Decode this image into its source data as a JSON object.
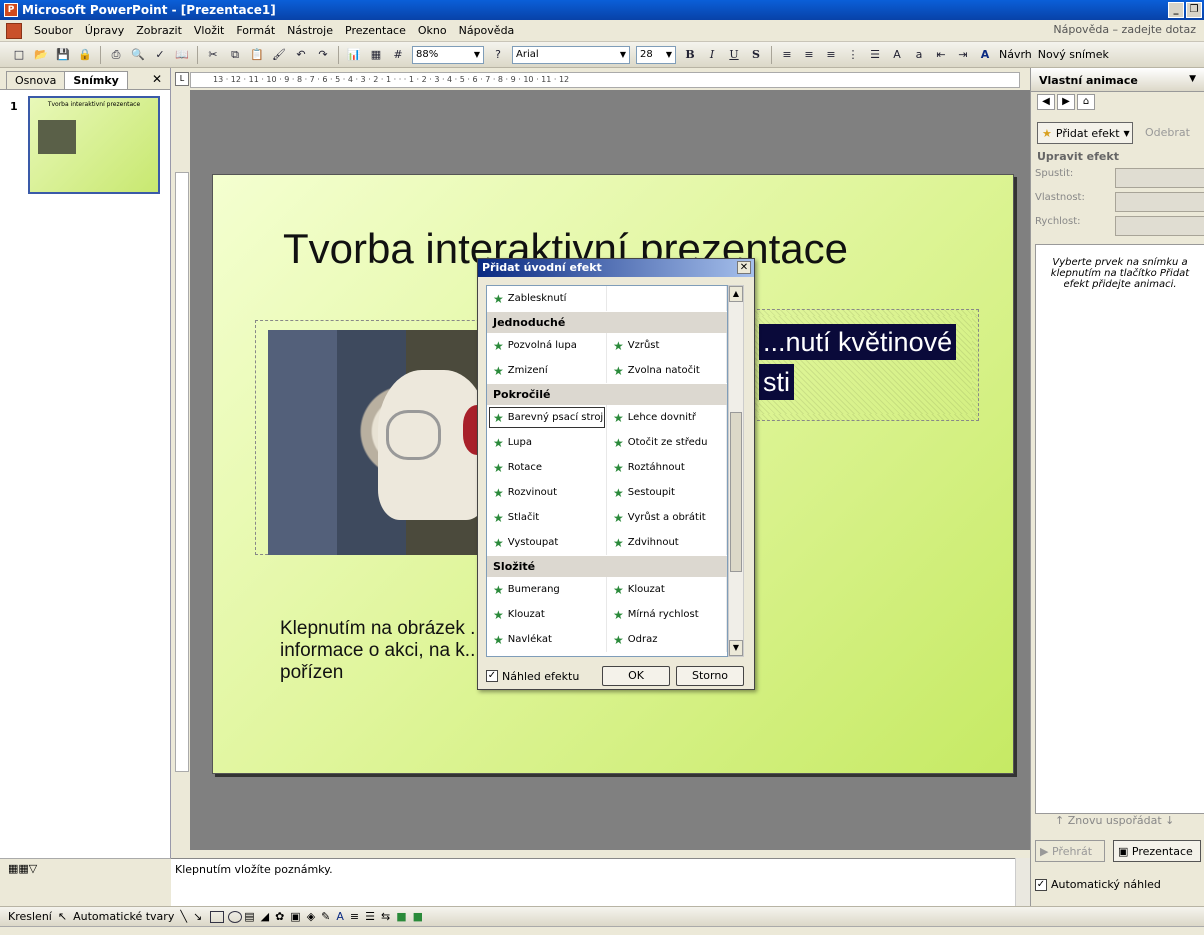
{
  "window": {
    "title": "Microsoft PowerPoint - [Prezentace1]"
  },
  "menu": {
    "items": [
      "Soubor",
      "Úpravy",
      "Zobrazit",
      "Vložit",
      "Formát",
      "Nástroje",
      "Prezentace",
      "Okno",
      "Nápověda"
    ],
    "help_placeholder": "Nápověda – zadejte dotaz"
  },
  "toolbar": {
    "zoom": "88%",
    "font": "Arial",
    "font_size": "28",
    "bold": "B",
    "italic": "I",
    "underline": "U",
    "shadow": "S",
    "design_label": "Návrh",
    "new_slide_label": "Nový snímek"
  },
  "slides_pane": {
    "tabs": [
      "Osnova",
      "Snímky"
    ],
    "active_tab": "Snímky",
    "slide_number": "1",
    "thumb_title": "Tvorba interaktivní prezentace"
  },
  "slide": {
    "title": "Tvorba interaktivní prezentace",
    "selected_text_line1": "...nutí květinové",
    "selected_text_line2": "sti",
    "body_text": "Klepnutím na obrázek ... informace o akci, na k... pořízen"
  },
  "notes": {
    "placeholder": "Klepnutím vložíte poznámky."
  },
  "drawing": {
    "draw_label": "Kreslení",
    "autoshapes_label": "Automatické tvary"
  },
  "task_pane": {
    "title": "Vlastní animace",
    "add_effect": "Přidat efekt",
    "remove": "Odebrat",
    "modify_section": "Upravit efekt",
    "start_label": "Spustit:",
    "property_label": "Vlastnost:",
    "speed_label": "Rychlost:",
    "hint": "Vyberte prvek na snímku a klepnutím na tlačítko Přidat efekt přidejte animaci.",
    "reorder": "Znovu uspořádat",
    "play": "Přehrát",
    "slideshow": "Prezentace",
    "auto_preview": "Automatický náhled"
  },
  "dialog": {
    "title": "Přidat úvodní efekt",
    "top_item": "Zablesknutí",
    "groups": [
      {
        "name": "Jednoduché",
        "rows": [
          [
            "Pozvolná lupa",
            "Vzrůst"
          ],
          [
            "Zmizení",
            "Zvolna natočit"
          ]
        ]
      },
      {
        "name": "Pokročilé",
        "rows": [
          [
            "Barevný psací stroj",
            "Lehce dovnitř"
          ],
          [
            "Lupa",
            "Otočit ze středu"
          ],
          [
            "Rotace",
            "Roztáhnout"
          ],
          [
            "Rozvinout",
            "Sestoupit"
          ],
          [
            "Stlačit",
            "Vyrůst a obrátit"
          ],
          [
            "Vystoupat",
            "Zdvihnout"
          ]
        ]
      },
      {
        "name": "Složité",
        "rows": [
          [
            "Bumerang",
            "Klouzat"
          ],
          [
            "Klouzat",
            "Mírná rychlost"
          ],
          [
            "Navlékat",
            "Odraz"
          ]
        ]
      }
    ],
    "selected_effect": "Barevný psací stroj",
    "preview_label": "Náhled efektu",
    "ok": "OK",
    "cancel": "Storno"
  }
}
